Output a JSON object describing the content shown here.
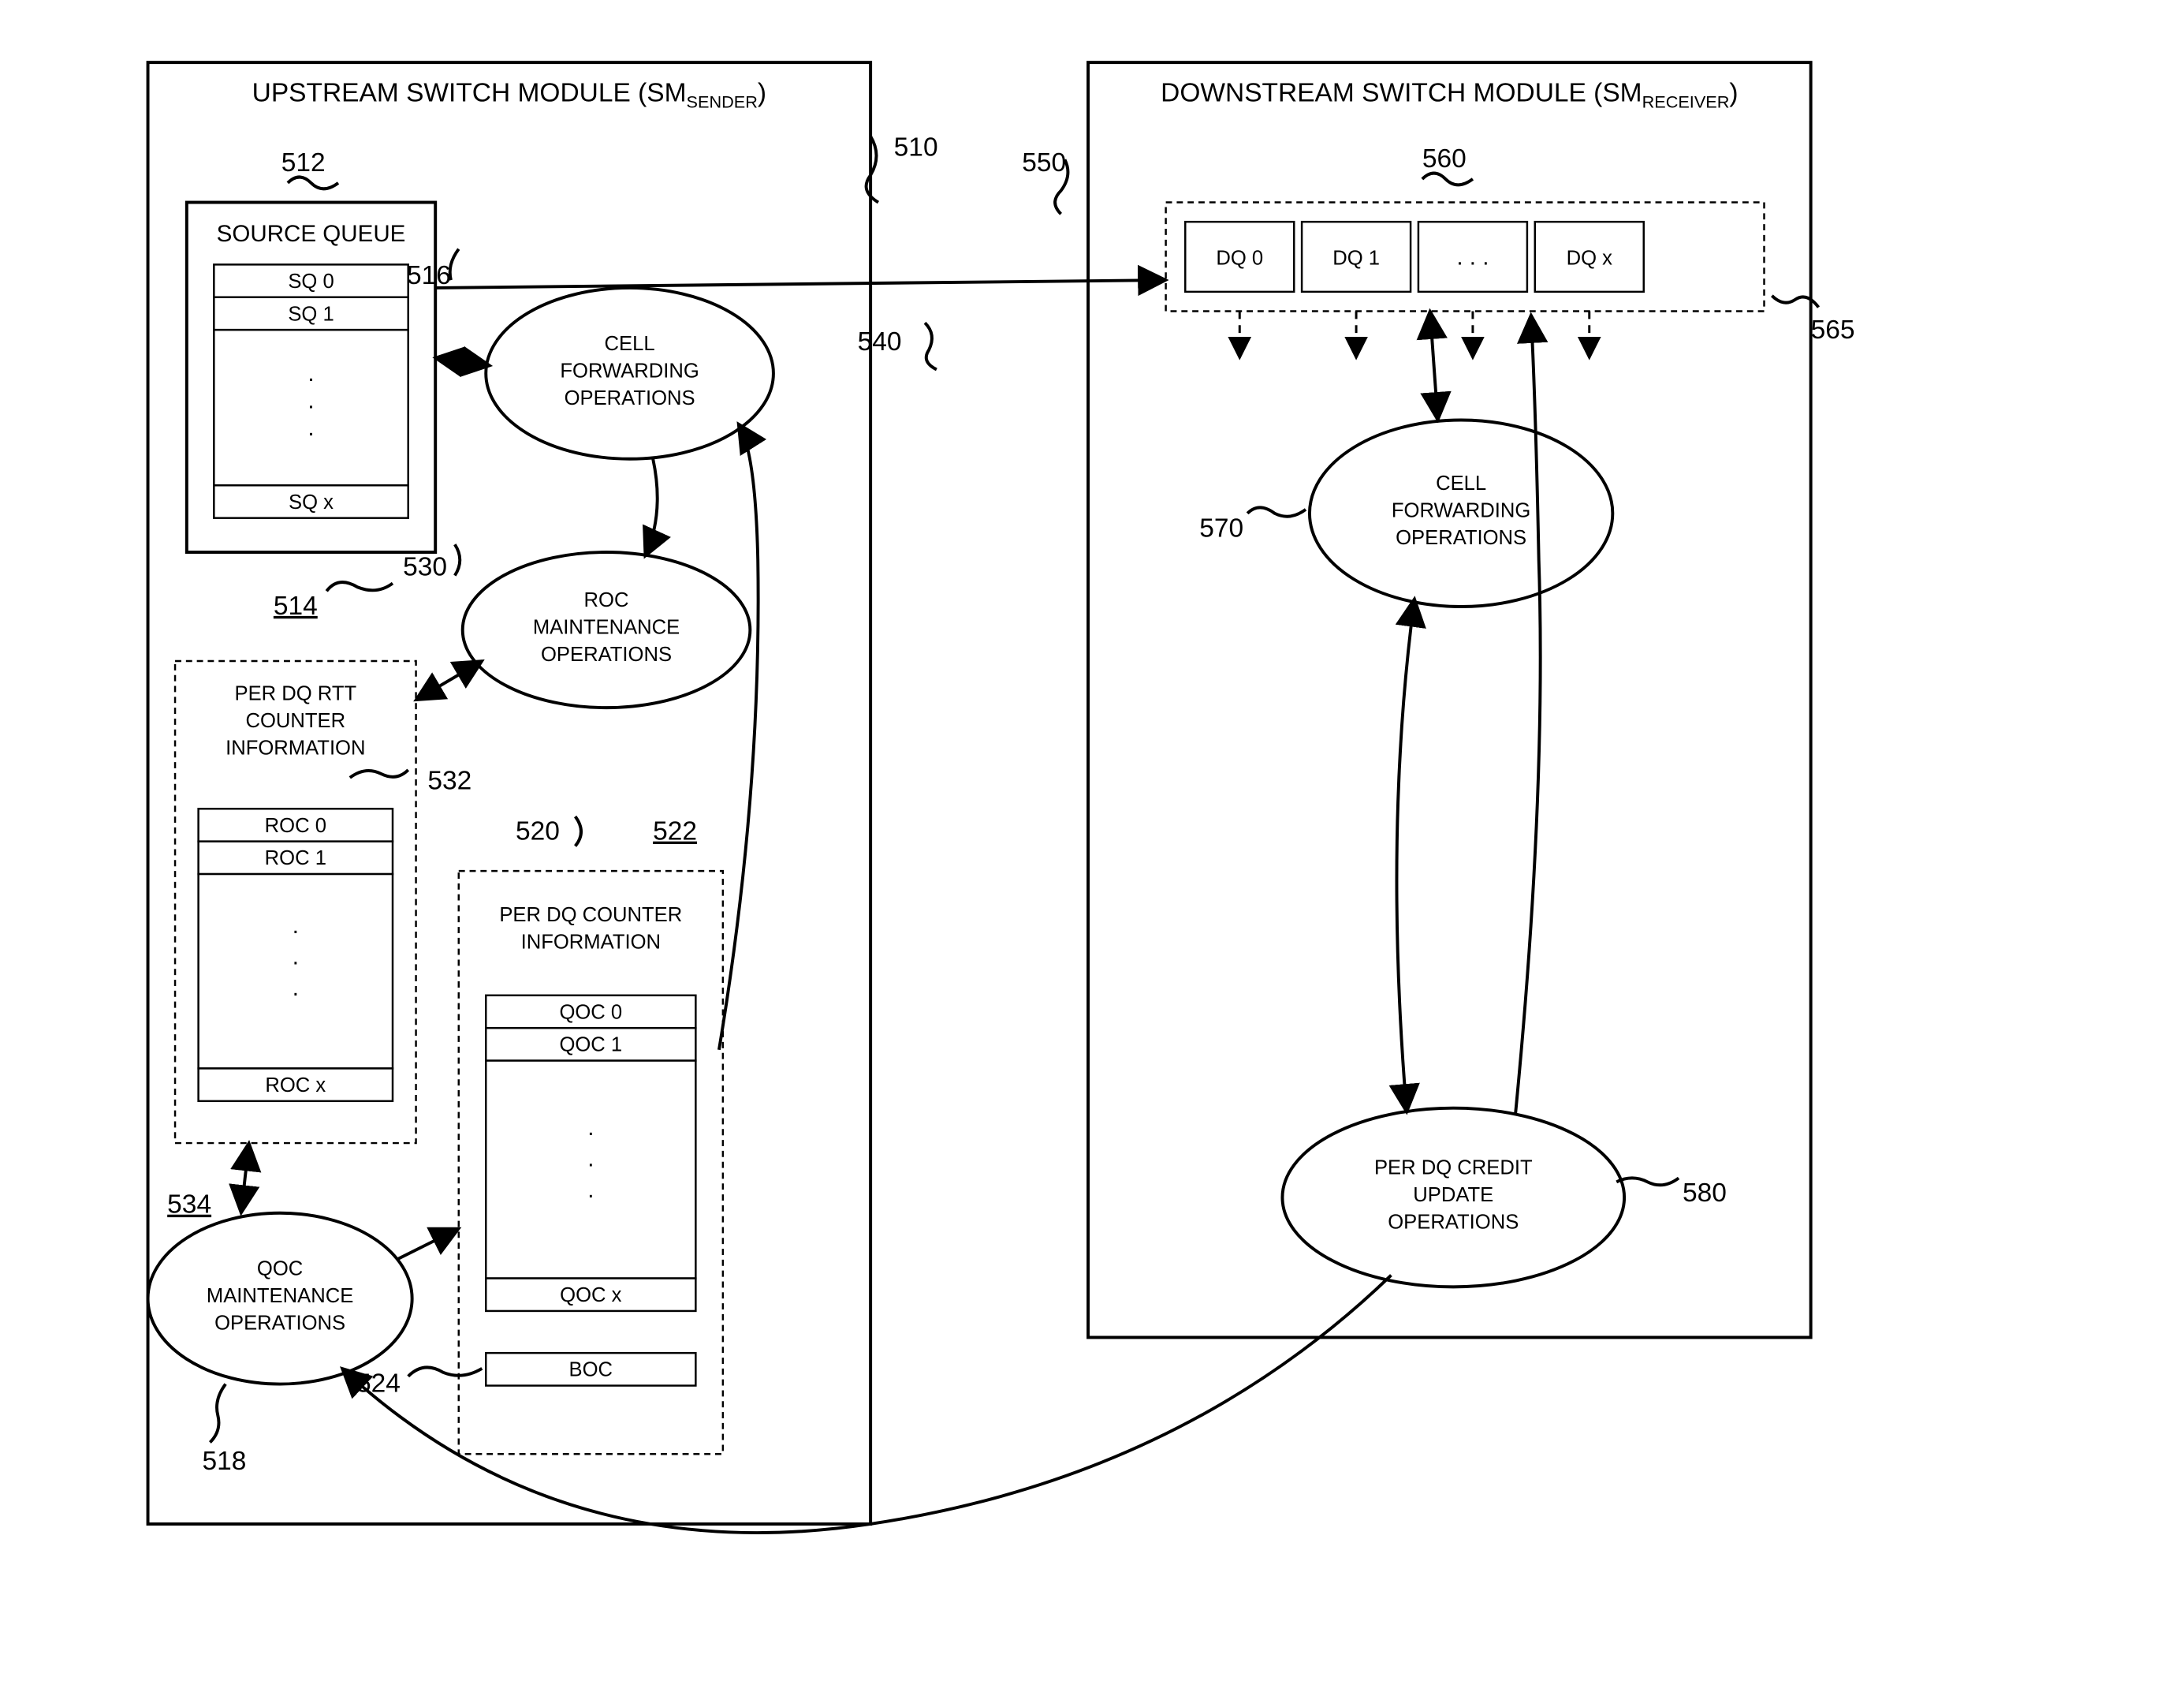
{
  "upstream": {
    "title": "UPSTREAM SWITCH MODULE (SM",
    "subscript": "SENDER",
    "close": ")",
    "sourceQueue": {
      "title": "SOURCE QUEUE",
      "rows": [
        "SQ 0",
        "SQ 1",
        "SQ x"
      ]
    },
    "perDQRtt": {
      "title1": "PER DQ RTT",
      "title2": "COUNTER",
      "title3": "INFORMATION",
      "rows": [
        "ROC 0",
        "ROC 1",
        "ROC x"
      ]
    },
    "perDQCounter": {
      "title1": "PER DQ COUNTER",
      "title2": "INFORMATION",
      "rows": [
        "QOC 0",
        "QOC 1",
        "QOC x",
        "BOC"
      ]
    },
    "cellFwd": {
      "l1": "CELL",
      "l2": "FORWARDING",
      "l3": "OPERATIONS"
    },
    "roc": {
      "l1": "ROC",
      "l2": "MAINTENANCE",
      "l3": "OPERATIONS"
    },
    "qoc": {
      "l1": "QOC",
      "l2": "MAINTENANCE",
      "l3": "OPERATIONS"
    }
  },
  "downstream": {
    "title": "DOWNSTREAM SWITCH MODULE (SM",
    "subscript": "RECEIVER",
    "close": ")",
    "dq": [
      "DQ 0",
      "DQ 1",
      ". . .",
      "DQ x"
    ],
    "cellFwd": {
      "l1": "CELL",
      "l2": "FORWARDING",
      "l3": "OPERATIONS"
    },
    "credit": {
      "l1": "PER DQ CREDIT",
      "l2": "UPDATE",
      "l3": "OPERATIONS"
    }
  },
  "refs": {
    "r510": "510",
    "r512": "512",
    "r514": "514",
    "r516": "516",
    "r518": "518",
    "r520": "520",
    "r522": "522",
    "r524": "524",
    "r530": "530",
    "r532": "532",
    "r534": "534",
    "r540": "540",
    "r550": "550",
    "r560": "560",
    "r565": "565",
    "r570": "570",
    "r580": "580"
  }
}
